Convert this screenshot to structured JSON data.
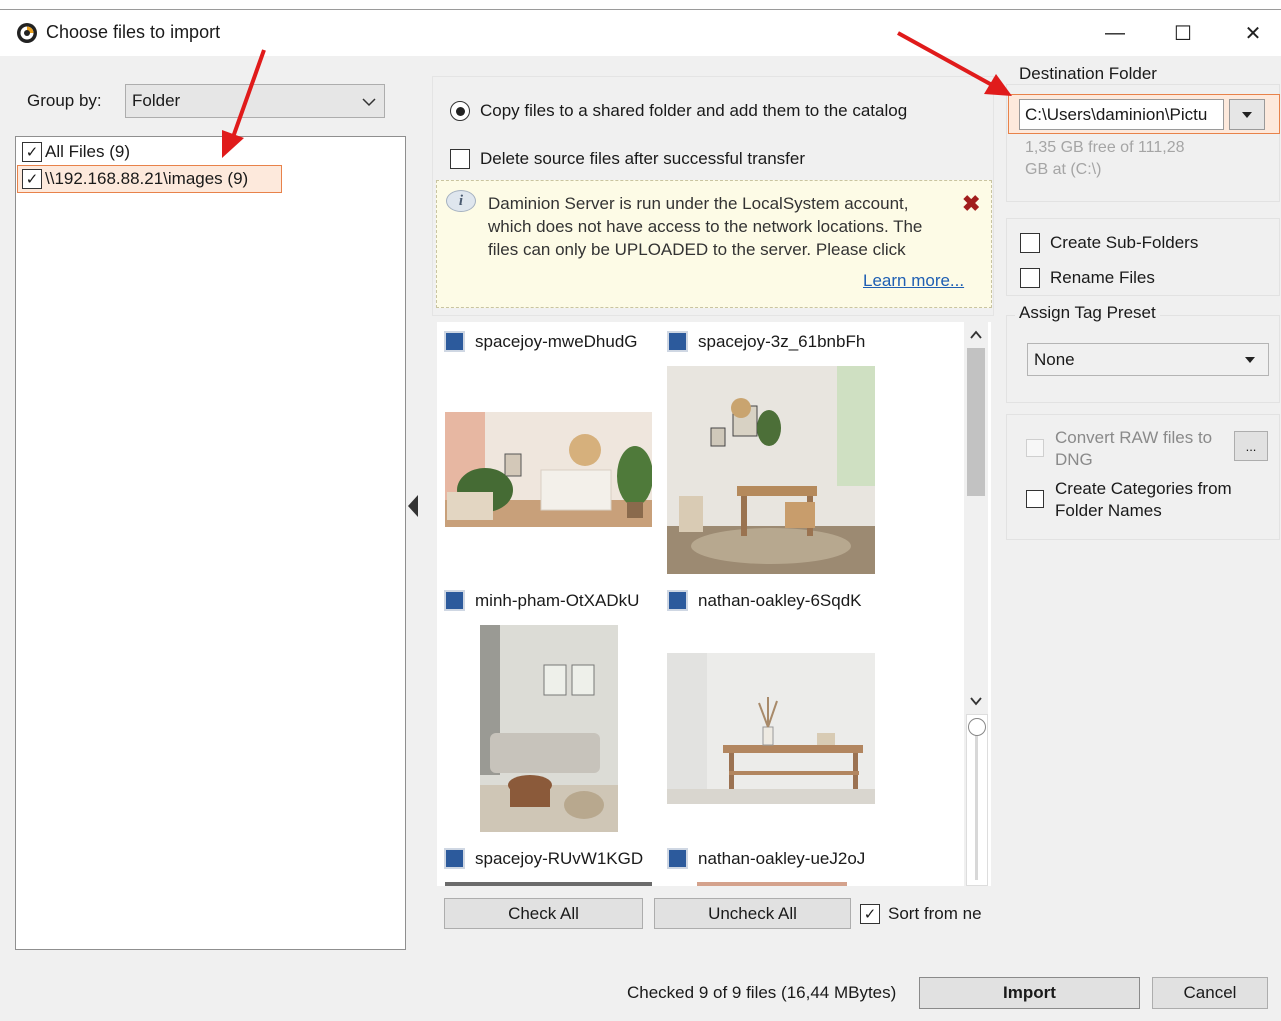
{
  "window": {
    "title": "Choose files to import",
    "minimize": "—",
    "maximize": "☐",
    "close": "✕"
  },
  "left": {
    "group_by_label": "Group by:",
    "group_by_value": "Folder",
    "tree": [
      {
        "label": "All Files (9)",
        "checked": true
      },
      {
        "label": "\\\\192.168.88.21\\images (9)",
        "checked": true
      }
    ]
  },
  "options": {
    "copy_label": "Copy files to a shared folder and add them to the catalog",
    "delete_label": "Delete source files after successful transfer"
  },
  "warning": {
    "text": "Daminion Server is run under the LocalSystem account, which does not have access to the network locations. The files can only be UPLOADED to the server. Please click",
    "link": "Learn more..."
  },
  "thumbnails": [
    {
      "name": "spacejoy-mweDhudG"
    },
    {
      "name": "spacejoy-3z_61bnbFh"
    },
    {
      "name": "minh-pham-OtXADkU"
    },
    {
      "name": "nathan-oakley-6SqdK"
    },
    {
      "name": "spacejoy-RUvW1KGD"
    },
    {
      "name": "nathan-oakley-ueJ2oJ"
    }
  ],
  "bottom_buttons": {
    "check_all": "Check All",
    "uncheck_all": "Uncheck All",
    "sort_label": "Sort from ne"
  },
  "destination": {
    "heading": "Destination Folder",
    "path": "C:\\Users\\daminion\\Pictu",
    "free_space": "1,35 GB free of 111,28 GB at  (C:\\)"
  },
  "file_options": {
    "sub_folders": "Create Sub-Folders",
    "rename": "Rename Files"
  },
  "tag_preset": {
    "heading": "Assign Tag Preset",
    "value": "None"
  },
  "extra": {
    "convert_raw": "Convert RAW files to DNG",
    "convert_btn": "...",
    "categories": "Create Categories from Folder Names"
  },
  "footer": {
    "status": "Checked 9 of 9 files (16,44 MBytes)",
    "import": "Import",
    "cancel": "Cancel"
  },
  "colors": {
    "accent_red": "#e01b1b",
    "highlight_border": "#e8824a",
    "highlight_fill": "#fde9dc",
    "warning_bg": "#fdfbe6",
    "link": "#1f5fb3"
  }
}
